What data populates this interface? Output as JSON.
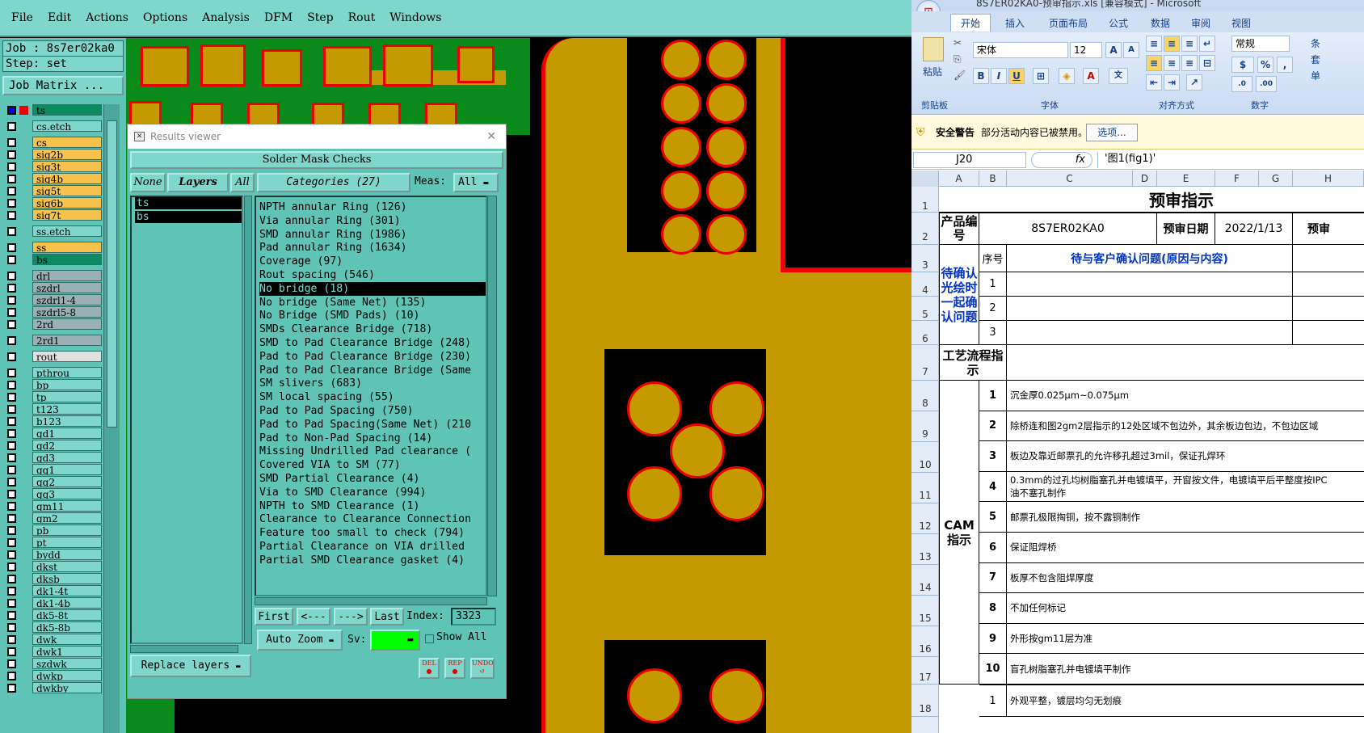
{
  "cam": {
    "menu": [
      "File",
      "Edit",
      "Actions",
      "Options",
      "Analysis",
      "DFM",
      "Step",
      "Rout",
      "Windows"
    ],
    "job_label": "Job : 8s7er02ka0",
    "step_label": "Step: set",
    "job_matrix": "Job Matrix ...",
    "layers": [
      {
        "name": "ts",
        "color": "#0c8a60",
        "active": true
      },
      {
        "name": "cs.etch",
        "color": "#7fd6cb"
      },
      {
        "name": "cs",
        "color": "#f6c24c"
      },
      {
        "name": "sig2b",
        "color": "#f6c24c"
      },
      {
        "name": "sig3t",
        "color": "#f6c24c"
      },
      {
        "name": "sig4b",
        "color": "#f6c24c"
      },
      {
        "name": "sig5t",
        "color": "#f6c24c"
      },
      {
        "name": "sig6b",
        "color": "#f6c24c"
      },
      {
        "name": "sig7t",
        "color": "#f6c24c"
      },
      {
        "name": "ss.etch",
        "color": "#7fd6cb"
      },
      {
        "name": "ss",
        "color": "#f6c24c"
      },
      {
        "name": "bs",
        "color": "#0c8a60"
      },
      {
        "name": "drl",
        "color": "#9ab0b4"
      },
      {
        "name": "szdrl",
        "color": "#9ab0b4"
      },
      {
        "name": "szdrl1-4",
        "color": "#9ab0b4"
      },
      {
        "name": "szdrl5-8",
        "color": "#9ab0b4"
      },
      {
        "name": "2rd",
        "color": "#9ab0b4"
      },
      {
        "name": "2rd1",
        "color": "#9ab0b4"
      },
      {
        "name": "rout",
        "color": "#e0e0e0"
      },
      {
        "name": "pthrou",
        "color": "#7fd6cb"
      },
      {
        "name": "bp",
        "color": "#7fd6cb"
      },
      {
        "name": "tp",
        "color": "#7fd6cb"
      },
      {
        "name": "t123",
        "color": "#7fd6cb"
      },
      {
        "name": "b123",
        "color": "#7fd6cb"
      },
      {
        "name": "gd1",
        "color": "#7fd6cb"
      },
      {
        "name": "gd2",
        "color": "#7fd6cb"
      },
      {
        "name": "gd3",
        "color": "#7fd6cb"
      },
      {
        "name": "gg1",
        "color": "#7fd6cb"
      },
      {
        "name": "gg2",
        "color": "#7fd6cb"
      },
      {
        "name": "gg3",
        "color": "#7fd6cb"
      },
      {
        "name": "gm11",
        "color": "#7fd6cb"
      },
      {
        "name": "gm2",
        "color": "#7fd6cb"
      },
      {
        "name": "pb",
        "color": "#7fd6cb"
      },
      {
        "name": "pt",
        "color": "#7fd6cb"
      },
      {
        "name": "bydd",
        "color": "#7fd6cb"
      },
      {
        "name": "dkst",
        "color": "#7fd6cb"
      },
      {
        "name": "dksb",
        "color": "#7fd6cb"
      },
      {
        "name": "dk1-4t",
        "color": "#7fd6cb"
      },
      {
        "name": "dk1-4b",
        "color": "#7fd6cb"
      },
      {
        "name": "dk5-8t",
        "color": "#7fd6cb"
      },
      {
        "name": "dk5-8b",
        "color": "#7fd6cb"
      },
      {
        "name": "dwk",
        "color": "#7fd6cb"
      },
      {
        "name": "dwk1",
        "color": "#7fd6cb"
      },
      {
        "name": "szdwk",
        "color": "#7fd6cb"
      },
      {
        "name": "dwkp",
        "color": "#7fd6cb"
      },
      {
        "name": "dwkby",
        "color": "#7fd6cb"
      }
    ],
    "results_viewer": {
      "title": "Results viewer",
      "header": "Solder Mask Checks",
      "none_btn": "None",
      "layers_btn": "Layers",
      "all_btn": "All",
      "categories_btn": "Categories (27)",
      "meas_label": "Meas:",
      "meas_value": "All",
      "layer_items": [
        "ts",
        "bs"
      ],
      "categories": [
        "NPTH annular Ring (126)",
        "Via annular Ring (301)",
        "SMD annular Ring (1986)",
        "Pad annular Ring (1634)",
        "Coverage (97)",
        "Rout spacing (546)",
        "No bridge (18)",
        "No bridge (Same Net) (135)",
        "No Bridge (SMD Pads) (10)",
        "SMDs Clearance Bridge (718)",
        "SMD to Pad Clearance Bridge (248)",
        "Pad to Pad Clearance Bridge (230)",
        "Pad to Pad Clearance Bridge (Same",
        "SM slivers (683)",
        "SM local spacing (55)",
        "Pad to Pad Spacing (750)",
        "Pad to Pad Spacing(Same Net) (210",
        "Pad to Non-Pad Spacing (14)",
        "Missing Undrilled Pad clearance (",
        "Covered VIA to SM (77)",
        "SMD Partial Clearance (4)",
        "Via to SMD Clearance (994)",
        "NPTH to SMD Clearance (1)",
        "Clearance to Clearance Connection",
        "Feature too small to check (794)",
        "Partial Clearance on VIA drilled",
        "Partial SMD Clearance gasket (4)"
      ],
      "selected_index": 6,
      "first_btn": "First",
      "prev_btn": "<---",
      "next_btn": "--->",
      "last_btn": "Last",
      "index_label": "Index:",
      "index_value": "3323",
      "auto_zoom_btn": "Auto Zoom",
      "sv_label": "Sv:",
      "show_all": "Show All",
      "replace_layers_btn": "Replace layers",
      "del_btn": "DEL",
      "rep_btn": "REP",
      "undo_btn": "UNDO"
    }
  },
  "excel": {
    "title_partial": "8S7ER02KA0-预审指示.xls [兼容模式] - Microsoft",
    "tabs": [
      "开始",
      "插入",
      "页面布局",
      "公式",
      "数据",
      "审阅",
      "视图"
    ],
    "clipboard_paste": "粘贴",
    "clipboard_group": "剪贴板",
    "font_name": "宋体",
    "font_size": "12",
    "font_group": "字体",
    "align_group": "对齐方式",
    "number_format": "常规",
    "number_group": "数字",
    "right_edge": [
      "条",
      "套",
      "单"
    ],
    "security_warning": "安全警告",
    "security_msg": "部分活动内容已被禁用。",
    "options_btn": "选项...",
    "name_box": "J20",
    "fx": "fx",
    "formula": "'图1(fig1)'",
    "columns": [
      "A",
      "B",
      "C",
      "D",
      "E",
      "F",
      "G",
      "H"
    ],
    "rows": [
      "1",
      "2",
      "3",
      "4",
      "5",
      "6",
      "7",
      "8",
      "9",
      "10",
      "11",
      "12",
      "13",
      "14",
      "15",
      "16",
      "17",
      "18"
    ],
    "sheet_title": "预审指示",
    "product_label": "产品编号",
    "product_no": "8S7ER02KA0",
    "review_date_label": "预审日期",
    "review_date": "2022/1/13",
    "review_cut": "预审",
    "seq_label": "序号",
    "pending_header": "待与客户确认问题(原因与内容)",
    "pending_side": "待确认光绘时一起确认问题",
    "pending_nums": [
      "1",
      "2",
      "3"
    ],
    "process_label": "工艺流程指示",
    "cam_label": "CAM指示",
    "cam_items": [
      {
        "no": "1",
        "text": "沉金厚0.025μm~0.075μm"
      },
      {
        "no": "2",
        "text": "除桥连和图2gm2层指示的12处区域不包边外，其余板边包边，不包边区域"
      },
      {
        "no": "3",
        "text": "板边及靠近邮票孔的允许移孔超过3mil，保证孔焊环"
      },
      {
        "no": "4",
        "text": "0.3mm的过孔均树脂塞孔并电镀填平，开窗按文件，电镀填平后平整度按IPC",
        "text2": "油不塞孔制作"
      },
      {
        "no": "5",
        "text": "邮票孔极限掏铜，按不露铜制作"
      },
      {
        "no": "6",
        "text": "保证阻焊桥"
      },
      {
        "no": "7",
        "text": "板厚不包含阻焊厚度"
      },
      {
        "no": "8",
        "text": "不加任何标记"
      },
      {
        "no": "9",
        "text": "外形按gm11层为准"
      },
      {
        "no": "10",
        "text": "盲孔树脂塞孔并电镀填平制作"
      }
    ],
    "last_row": {
      "no": "1",
      "text": "外观平整，镀层均匀无划痕"
    }
  }
}
